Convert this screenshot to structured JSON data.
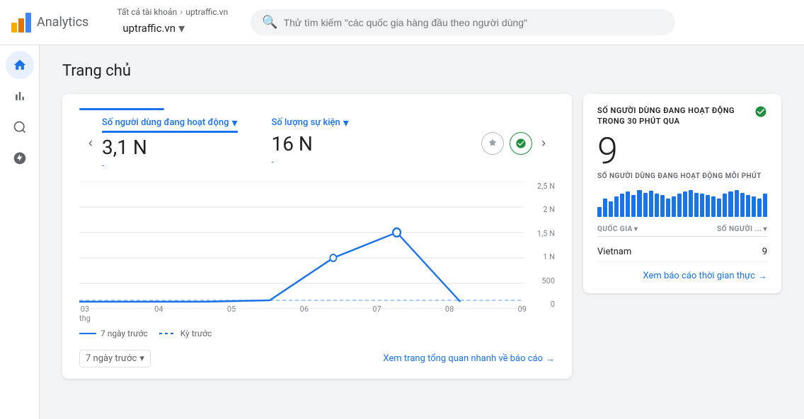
{
  "app": {
    "name": "Analytics"
  },
  "topbar": {
    "breadcrumb_all": "Tất cả tài khoản",
    "breadcrumb_sep": "›",
    "breadcrumb_property": "uptraffic.vn",
    "property_label": "uptraffic.vn",
    "search_placeholder": "Thử tìm kiếm \"các quốc gia hàng đầu theo người dùng\""
  },
  "sidebar": {
    "items": [
      {
        "label": "home",
        "icon": "⌂",
        "active": true
      },
      {
        "label": "reports",
        "icon": "📊",
        "active": false
      },
      {
        "label": "explore",
        "icon": "🔍",
        "active": false
      },
      {
        "label": "configure",
        "icon": "📡",
        "active": false
      }
    ]
  },
  "page": {
    "title": "Trang chủ"
  },
  "main_card": {
    "metric1_label": "Số người dùng đang hoạt động",
    "metric1_value": "3,1 N",
    "metric1_sub": "-",
    "metric2_label": "Số lượng sự kiện",
    "metric2_value": "16 N",
    "metric2_sub": "-",
    "date_label": "7 ngày trước",
    "view_report_label": "Xem trang tổng quan nhanh về báo cáo",
    "legend_current": "7 ngày trước",
    "legend_prev": "Kỳ trước",
    "y_labels": [
      "2,5 N",
      "2 N",
      "1,5 N",
      "1 N",
      "500",
      "0"
    ],
    "x_labels": [
      {
        "date": "03",
        "month": "thg"
      },
      {
        "date": "04",
        "month": ""
      },
      {
        "date": "05",
        "month": ""
      },
      {
        "date": "06",
        "month": ""
      },
      {
        "date": "07",
        "month": ""
      },
      {
        "date": "08",
        "month": ""
      },
      {
        "date": "09",
        "month": ""
      }
    ]
  },
  "realtime_card": {
    "title": "SỐ NGƯỜI DÙNG ĐANG HOẠT ĐỘNG TRONG 30 PHÚT QUA",
    "big_number": "9",
    "subtitle": "SỐ NGƯỜI DÙNG ĐANG HOẠT ĐỘNG MỖI PHÚT",
    "col1_label": "QUỐC GIA",
    "col2_label": "SỐ NGƯỜI ...",
    "rows": [
      {
        "country": "Vietnam",
        "count": "9"
      }
    ],
    "view_report_label": "Xem báo cáo thời gian thực",
    "bar_heights": [
      30,
      55,
      45,
      60,
      70,
      75,
      65,
      80,
      72,
      78,
      68,
      65,
      55,
      60,
      70,
      75,
      80,
      72,
      68,
      65,
      60,
      55,
      70,
      75,
      80,
      72,
      65,
      60,
      55,
      70
    ]
  }
}
